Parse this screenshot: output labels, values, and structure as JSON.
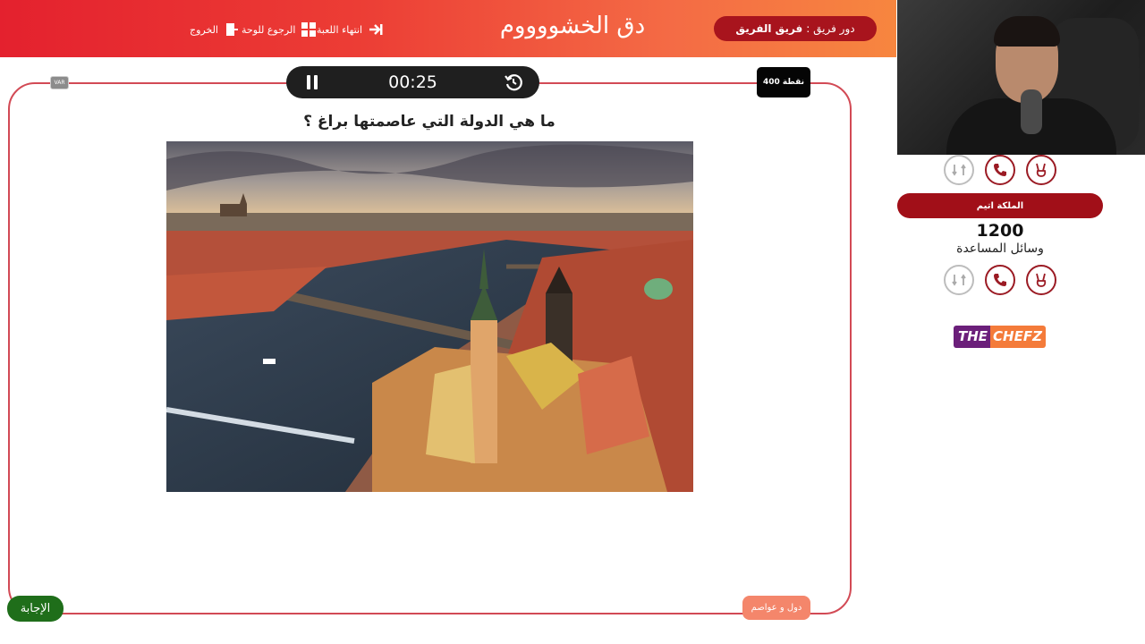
{
  "header": {
    "title": "دق الخشووووم",
    "nav": {
      "end_game": "انتهاء اللعبة",
      "back_to_board": "الرجوع للوحة",
      "exit": "الخروج"
    },
    "turn": {
      "prefix": "دور فريق :",
      "team": "فريق الفريق"
    }
  },
  "game": {
    "timer": "00:25",
    "points": "400 نقطة",
    "var_badge": "VAR",
    "question": "ما هي الدولة التي عاصمتها براغ ؟",
    "answer_button": "الإجابة",
    "category": "دول و عواصم"
  },
  "side_panel": {
    "team_name": "الملكة اتيم",
    "score": "1200",
    "aids_label": "وسائل المساعدة",
    "logo_part1": "THE",
    "logo_part2": "CHEFZ",
    "aids_top": [
      "two-fingers-icon",
      "phone-icon",
      "swap-icon"
    ],
    "aids_bottom": [
      "two-fingers-icon",
      "phone-icon",
      "swap-icon"
    ]
  },
  "colors": {
    "header_start": "#e4212e",
    "header_end": "#f7863f",
    "accent_dark_red": "#a10f18",
    "answer_green": "#1f6e1a",
    "category_orange": "#f4866b"
  }
}
